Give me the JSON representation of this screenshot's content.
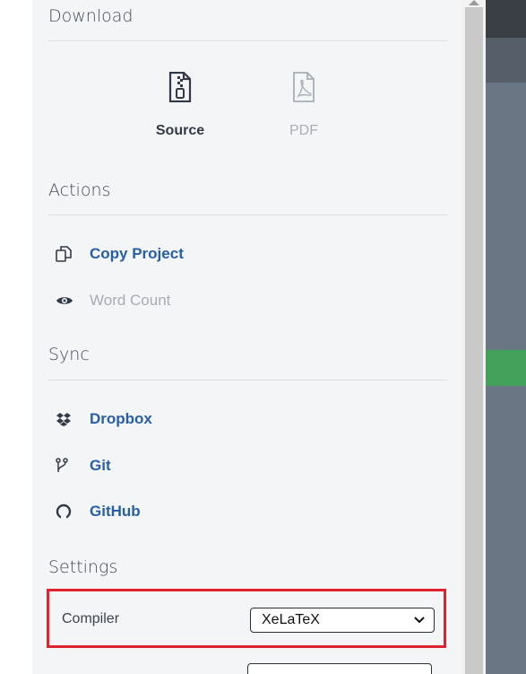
{
  "download": {
    "title": "Download",
    "source_label": "Source",
    "pdf_label": "PDF"
  },
  "actions": {
    "title": "Actions",
    "copy_project": "Copy Project",
    "word_count": "Word Count"
  },
  "sync": {
    "title": "Sync",
    "dropbox": "Dropbox",
    "git": "Git",
    "github": "GitHub"
  },
  "settings": {
    "title": "Settings",
    "compiler_label": "Compiler",
    "compiler_value": "XeLaTeX"
  },
  "colors": {
    "link": "#275ea8",
    "disabled": "#a7acb4",
    "highlight": "#e0242f"
  },
  "icons": [
    "zip-file-icon",
    "pdf-file-icon",
    "copy-icon",
    "eye-icon",
    "dropbox-icon",
    "git-icon",
    "github-icon",
    "chevron-down-icon"
  ]
}
